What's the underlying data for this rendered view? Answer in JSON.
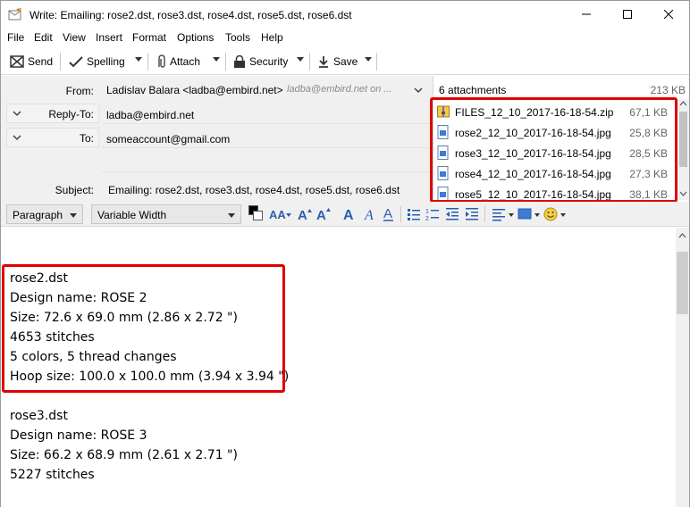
{
  "window": {
    "title": "Write: Emailing: rose2.dst, rose3.dst, rose4.dst, rose5.dst, rose6.dst"
  },
  "menu": [
    "File",
    "Edit",
    "View",
    "Insert",
    "Format",
    "Options",
    "Tools",
    "Help"
  ],
  "toolbar": {
    "send": "Send",
    "spelling": "Spelling",
    "attach": "Attach",
    "security": "Security",
    "save": "Save"
  },
  "header": {
    "from_label": "From:",
    "from_value": "Ladislav Balara <ladba@embird.net>",
    "from_extra": "ladba@embird.net on ...",
    "replyto_label": "Reply-To:",
    "replyto_value": "ladba@embird.net",
    "to_label": "To:",
    "to_value": "someaccount@gmail.com",
    "subject_label": "Subject:",
    "subject_value": "Emailing: rose2.dst, rose3.dst, rose4.dst, rose5.dst, rose6.dst"
  },
  "attachments": {
    "count_label": "6 attachments",
    "total_size": "213 KB",
    "items": [
      {
        "name": "FILES_12_10_2017-16-18-54.zip",
        "size": "67,1 KB",
        "icon": "zip-icon"
      },
      {
        "name": "rose2_12_10_2017-16-18-54.jpg",
        "size": "25,8 KB",
        "icon": "image-icon"
      },
      {
        "name": "rose3_12_10_2017-16-18-54.jpg",
        "size": "28,5 KB",
        "icon": "image-icon"
      },
      {
        "name": "rose4_12_10_2017-16-18-54.jpg",
        "size": "27,3 KB",
        "icon": "image-icon"
      },
      {
        "name": "rose5_12_10_2017-16-18-54.jpg",
        "size": "38,1 KB",
        "icon": "image-icon"
      }
    ]
  },
  "format": {
    "paragraph": "Paragraph",
    "font": "Variable Width"
  },
  "body": {
    "lines": [
      "rose2.dst",
      "Design name: ROSE 2",
      "Size: 72.6 x 69.0 mm (2.86 x 2.72 \")",
      "4653 stitches",
      "5 colors, 5 thread changes",
      "Hoop size: 100.0 x 100.0 mm (3.94 x 3.94 \")",
      "",
      "rose3.dst",
      "Design name: ROSE 3",
      "Size: 66.2 x 68.9 mm (2.61 x 2.71 \")",
      "5227 stitches"
    ]
  },
  "colors": {
    "highlight": "#e00000",
    "format_icon": "#2a5db0"
  }
}
